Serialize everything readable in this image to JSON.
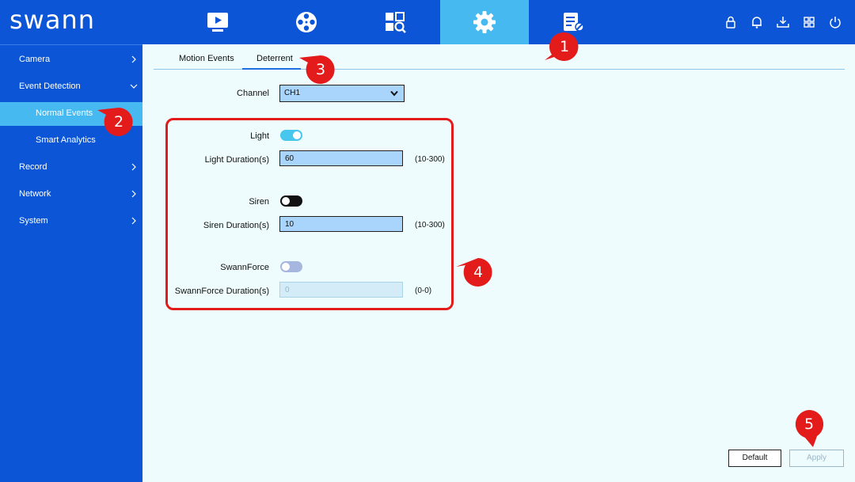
{
  "app": {
    "logo": "swann"
  },
  "nav": {
    "tabs": [
      {
        "name": "playback",
        "icon": "play-monitor-icon",
        "active": false
      },
      {
        "name": "recording",
        "icon": "film-reel-icon",
        "active": false
      },
      {
        "name": "search",
        "icon": "search-grid-icon",
        "active": false
      },
      {
        "name": "settings",
        "icon": "gear-icon",
        "active": true
      },
      {
        "name": "device-info",
        "icon": "document-wrench-icon",
        "active": false
      }
    ],
    "tools": [
      "lock-icon",
      "bell-icon",
      "download-icon",
      "grid-icon",
      "power-icon"
    ]
  },
  "sidebar": {
    "items": [
      {
        "label": "Camera",
        "chevron": "right"
      },
      {
        "label": "Event Detection",
        "chevron": "down"
      },
      {
        "label": "Normal Events",
        "sub": true,
        "active": true
      },
      {
        "label": "Smart Analytics",
        "sub": true
      },
      {
        "label": "Record",
        "chevron": "right"
      },
      {
        "label": "Network",
        "chevron": "right"
      },
      {
        "label": "System",
        "chevron": "right"
      }
    ]
  },
  "tabs": {
    "motion": "Motion Events",
    "deterrent": "Deterrent",
    "active": "Deterrent"
  },
  "channel": {
    "label": "Channel",
    "value": "CH1"
  },
  "deterrent": {
    "light": {
      "label": "Light",
      "on": true
    },
    "light_duration": {
      "label": "Light Duration(s)",
      "value": "60",
      "range": "(10-300)"
    },
    "siren": {
      "label": "Siren",
      "on": false
    },
    "siren_duration": {
      "label": "Siren Duration(s)",
      "value": "10",
      "range": "(10-300)"
    },
    "swannforce": {
      "label": "SwannForce",
      "on": false,
      "disabled": true
    },
    "swannforce_duration": {
      "label": "SwannForce Duration(s)",
      "value": "0",
      "range": "(0-0)"
    }
  },
  "buttons": {
    "default": "Default",
    "apply": "Apply"
  },
  "callouts": [
    "1",
    "2",
    "3",
    "4",
    "5"
  ],
  "colors": {
    "brand_blue": "#0b55d6",
    "active_blue": "#47b9f1",
    "highlight_red": "#e31b1b",
    "background": "#eefcfd"
  }
}
